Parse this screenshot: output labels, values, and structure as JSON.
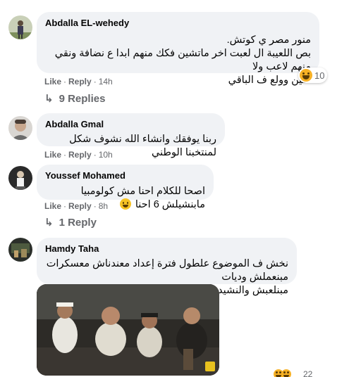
{
  "comments": [
    {
      "author": "Abdalla EL-wehedy",
      "lines": [
        "منور مصر ي كوتش.",
        "بص اللعيبة ال لعبت اخر ماتشين فكك منهم ابدا ع نضافة ونقي منهم لاعب ولا",
        "اتنين وولع ف الباقي"
      ],
      "actions": {
        "like": "Like",
        "reply": "Reply",
        "time": "14h"
      },
      "reaction_count": "10",
      "reactions_icon": "laughing-emoji-icon",
      "replies_label": "9 Replies"
    },
    {
      "author": "Abdalla Gmal",
      "lines": [
        "ربنا يوفقك وانشاء الله نشوف شكل لمنتخبنا الوطني"
      ],
      "actions": {
        "like": "Like",
        "reply": "Reply",
        "time": "10h"
      }
    },
    {
      "author": "Youssef Mohamed",
      "lines": [
        "اصحا للكلام احنا مش كولومبيا مابنشيلش 6 احنا"
      ],
      "actions": {
        "like": "Like",
        "reply": "Reply",
        "time": "8h"
      },
      "replies_label": "1 Reply"
    },
    {
      "author": "Hamdy Taha",
      "lines": [
        "نخش ف الموضوع علطول فترة إعداد معندناش معسكرات مبنعملش وديات",
        "مبنلعبش والنشيد الوطني مش حافظينه"
      ],
      "actions": {
        "count": "22"
      }
    }
  ],
  "colors": {
    "bubble": "#f0f2f5",
    "meta": "#65676b",
    "text": "#050505"
  }
}
